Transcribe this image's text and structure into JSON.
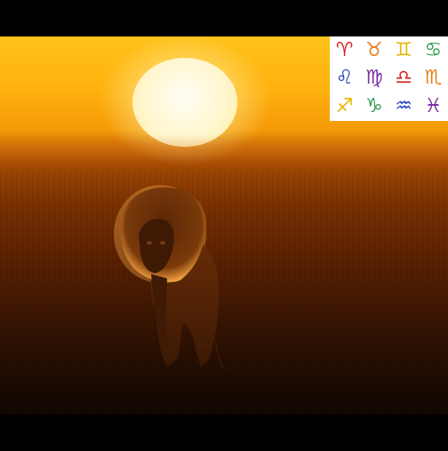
{
  "photo": {
    "subject": "lion walking toward camera at sunset",
    "sky_color": "#ffc21a",
    "ground_color": "#5e2202",
    "sun_color": "#fffef5"
  },
  "zodiac_grid": {
    "signs": [
      {
        "glyph": "♈",
        "name": "aries-icon",
        "color": "#d62828"
      },
      {
        "glyph": "♉",
        "name": "taurus-icon",
        "color": "#e67e22"
      },
      {
        "glyph": "♊",
        "name": "gemini-icon",
        "color": "#e6b800"
      },
      {
        "glyph": "♋",
        "name": "cancer-icon",
        "color": "#2e9e4f"
      },
      {
        "glyph": "♌",
        "name": "leo-icon",
        "color": "#1f3fbf"
      },
      {
        "glyph": "♍",
        "name": "virgo-icon",
        "color": "#7a2fa0"
      },
      {
        "glyph": "♎",
        "name": "libra-icon",
        "color": "#d62828"
      },
      {
        "glyph": "♏",
        "name": "scorpio-icon",
        "color": "#e67e22"
      },
      {
        "glyph": "♐",
        "name": "sagittarius-icon",
        "color": "#e6b800"
      },
      {
        "glyph": "♑",
        "name": "capricorn-icon",
        "color": "#2e9e4f"
      },
      {
        "glyph": "♒",
        "name": "aquarius-icon",
        "color": "#1f3fbf"
      },
      {
        "glyph": "♓",
        "name": "pisces-icon",
        "color": "#7a2fa0"
      }
    ]
  }
}
